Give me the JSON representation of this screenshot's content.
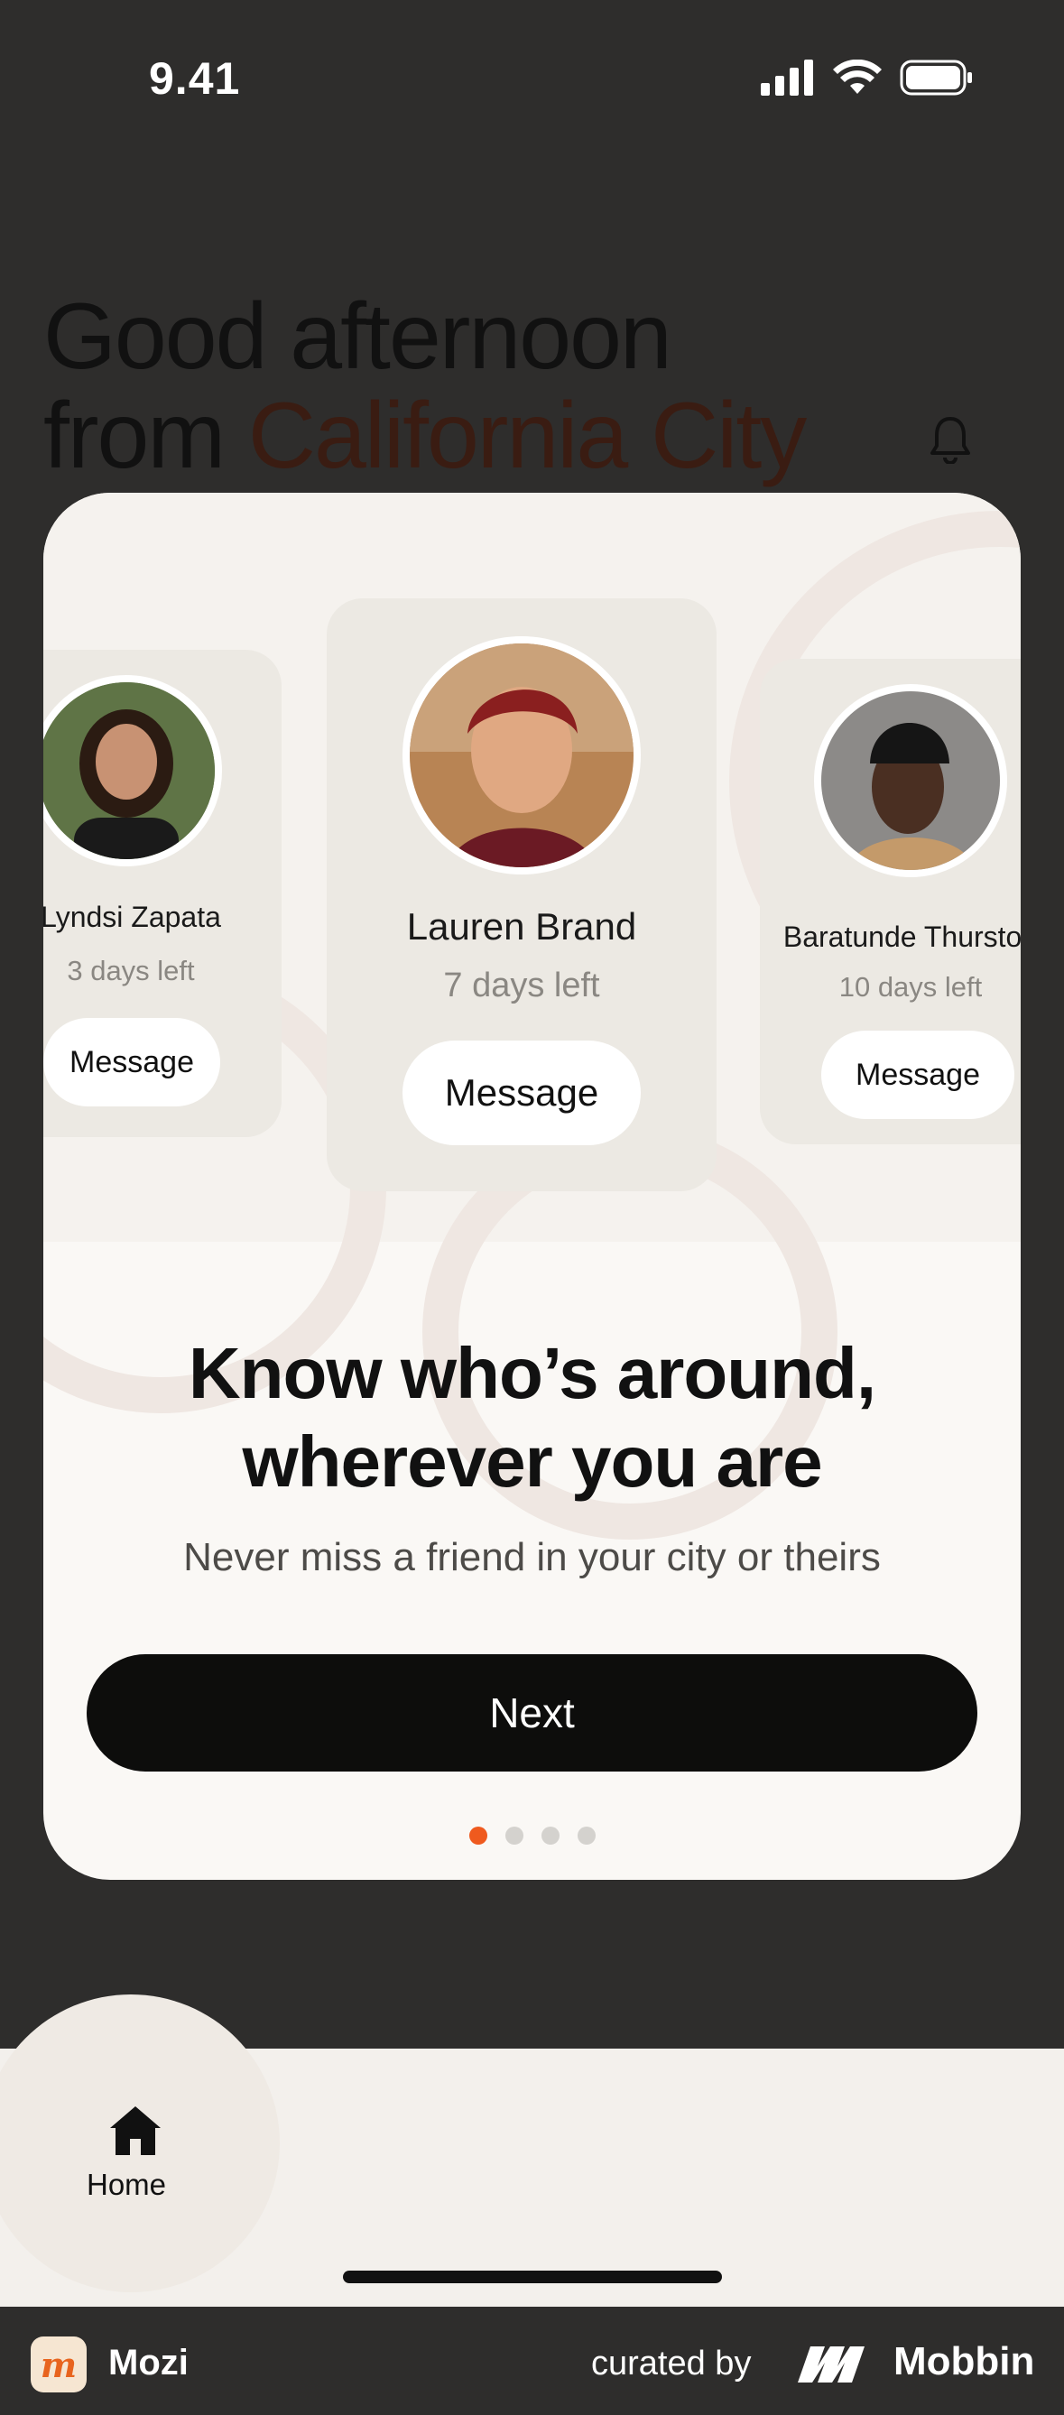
{
  "status_bar": {
    "time": "9.41"
  },
  "greeting": {
    "line1": "Good afternoon",
    "line2_prefix": "from ",
    "city": "California City"
  },
  "icons": {
    "bell": "bell-icon",
    "home": "home-icon",
    "signal": "signal-icon",
    "wifi": "wifi-icon",
    "battery": "battery-icon"
  },
  "carousel": {
    "profiles": [
      {
        "name": "Lyndsi Zapata",
        "days_left": "3 days left",
        "button": "Message"
      },
      {
        "name": "Lauren Brand",
        "days_left": "7 days left",
        "button": "Message"
      },
      {
        "name": "Baratunde Thurston",
        "days_left": "10 days left",
        "button": "Message"
      }
    ]
  },
  "onboarding": {
    "headline_line1": "Know who’s around,",
    "headline_line2": "wherever you are",
    "subtitle": "Never miss a friend in your city or theirs",
    "next_button": "Next",
    "page_index": 1,
    "page_count": 4,
    "accent_color": "#ef5a1e"
  },
  "tabbar": {
    "home_label": "Home"
  },
  "footer": {
    "app_name": "Mozi",
    "curated_by": "curated by",
    "brand": "Mobbin"
  }
}
